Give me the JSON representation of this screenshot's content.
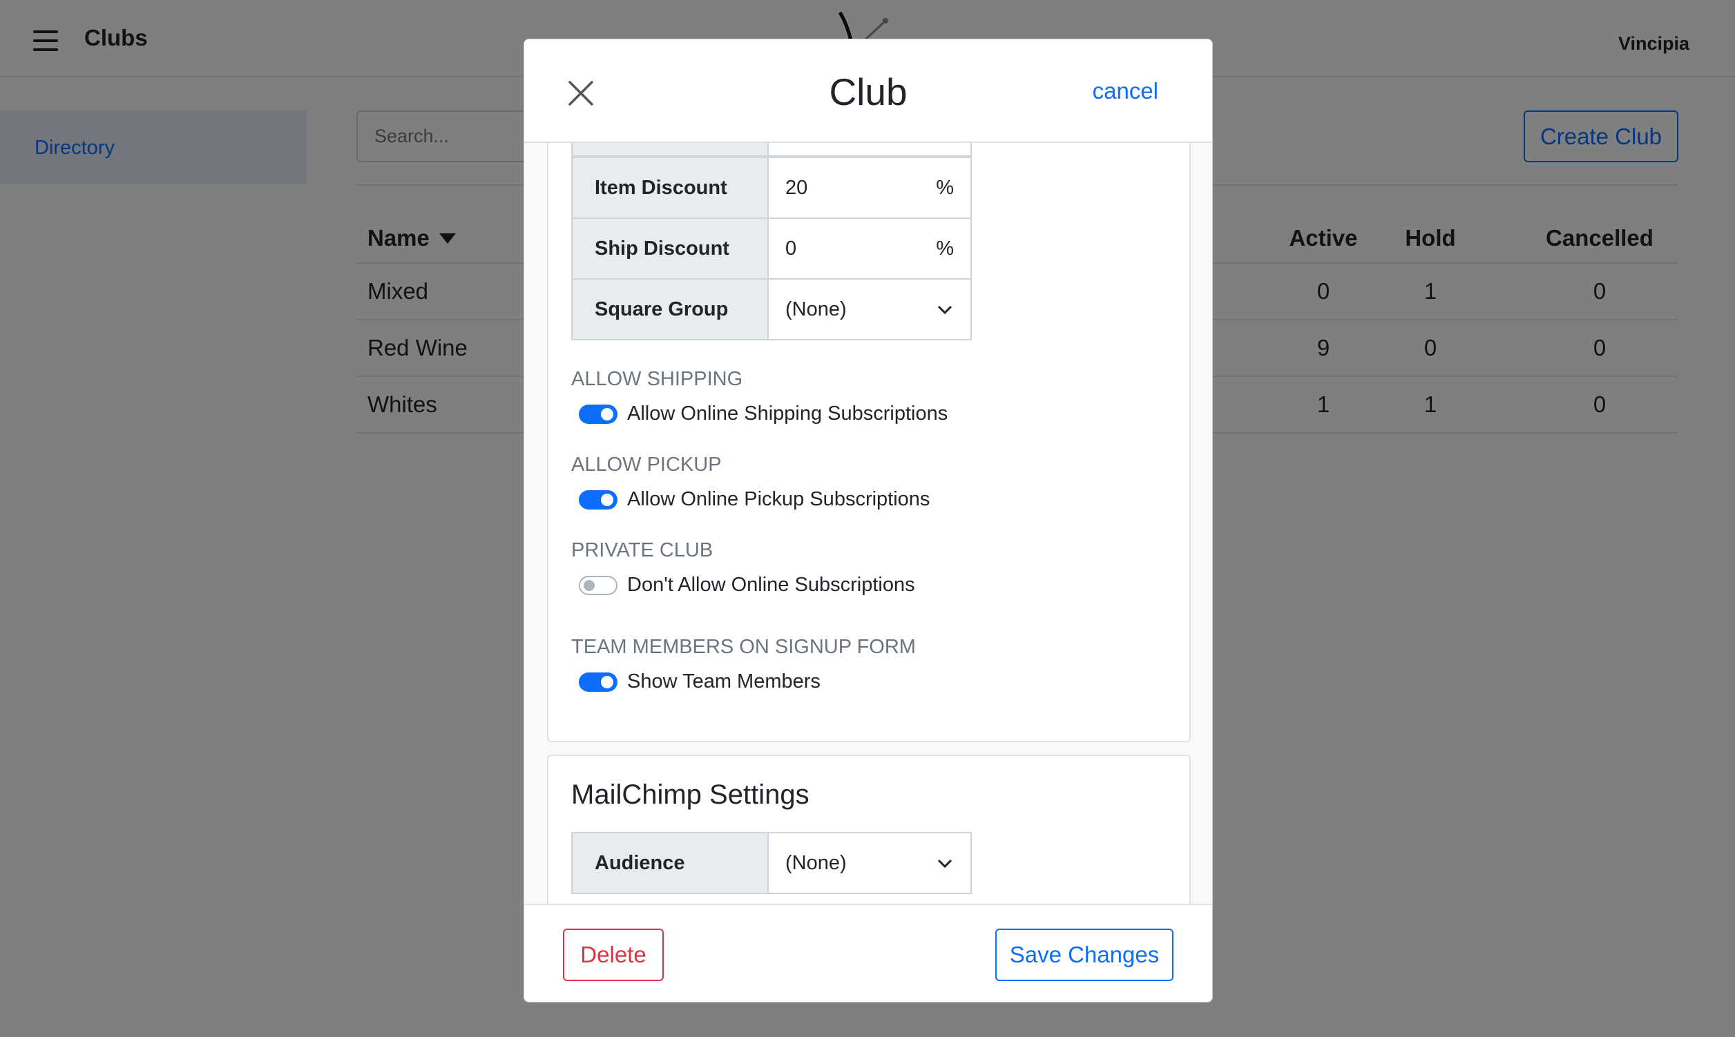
{
  "app": {
    "title": "Clubs",
    "user": "Vincipia"
  },
  "sidebar": {
    "items": [
      {
        "label": "Directory",
        "active": true
      }
    ]
  },
  "toolbar": {
    "search_placeholder": "Search...",
    "create_label": "Create Club"
  },
  "table": {
    "headers": {
      "name": "Name",
      "active": "Active",
      "hold": "Hold",
      "cancelled": "Cancelled"
    },
    "rows": [
      {
        "name": "Mixed",
        "active": "0",
        "hold": "1",
        "cancelled": "0"
      },
      {
        "name": "Red Wine",
        "active": "9",
        "hold": "0",
        "cancelled": "0"
      },
      {
        "name": "Whites",
        "active": "1",
        "hold": "1",
        "cancelled": "0"
      }
    ]
  },
  "modal": {
    "title": "Club",
    "cancel_label": "cancel",
    "fields": {
      "item_discount": {
        "label": "Item Discount",
        "value": "20",
        "unit": "%"
      },
      "ship_discount": {
        "label": "Ship Discount",
        "value": "0",
        "unit": "%"
      },
      "square_group": {
        "label": "Square Group",
        "value": "(None)"
      }
    },
    "toggles": {
      "shipping": {
        "section": "ALLOW SHIPPING",
        "label": "Allow Online Shipping Subscriptions",
        "on": true
      },
      "pickup": {
        "section": "ALLOW PICKUP",
        "label": "Allow Online Pickup Subscriptions",
        "on": true
      },
      "private": {
        "section": "PRIVATE CLUB",
        "label": "Don't Allow Online Subscriptions",
        "on": false
      },
      "team": {
        "section": "TEAM MEMBERS ON SIGNUP FORM",
        "label": "Show Team Members",
        "on": true
      }
    },
    "mailchimp": {
      "title": "MailChimp Settings",
      "audience": {
        "label": "Audience",
        "value": "(None)"
      }
    },
    "footer": {
      "delete_label": "Delete",
      "save_label": "Save Changes"
    }
  },
  "colors": {
    "primary": "#0d6efd",
    "danger": "#dc3545",
    "backdrop": "rgba(0,0,0,0.5)"
  }
}
